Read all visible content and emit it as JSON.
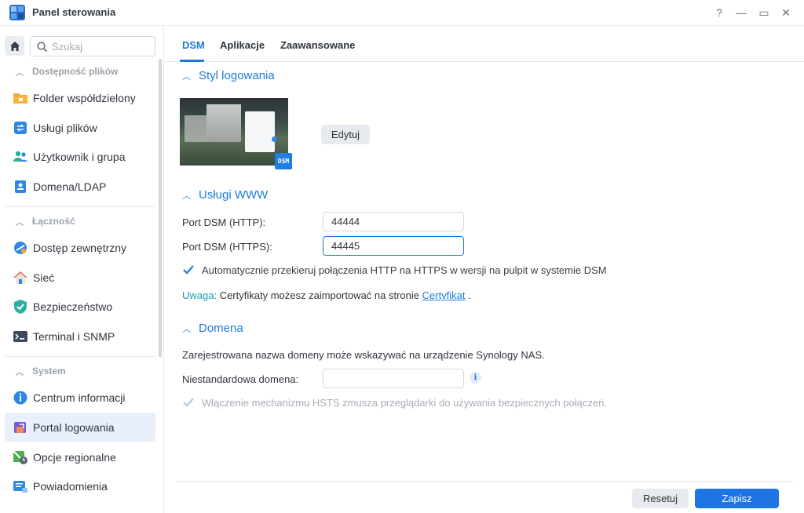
{
  "window": {
    "title": "Panel sterowania",
    "controls": {
      "help": "?",
      "minimize": "—",
      "maximize": "▭",
      "close": "✕"
    }
  },
  "sidebar": {
    "search_placeholder": "Szukaj",
    "groups": [
      {
        "label": "Dostępność plików",
        "items": [
          {
            "label": "Folder współdzielony",
            "icon": "shared-folder-icon"
          },
          {
            "label": "Usługi plików",
            "icon": "file-services-icon"
          },
          {
            "label": "Użytkownik i grupa",
            "icon": "user-group-icon"
          },
          {
            "label": "Domena/LDAP",
            "icon": "domain-ldap-icon"
          }
        ]
      },
      {
        "label": "Łączność",
        "items": [
          {
            "label": "Dostęp zewnętrzny",
            "icon": "external-access-icon"
          },
          {
            "label": "Sieć",
            "icon": "network-icon"
          },
          {
            "label": "Bezpieczeństwo",
            "icon": "security-shield-icon"
          },
          {
            "label": "Terminal i SNMP",
            "icon": "terminal-icon"
          }
        ]
      },
      {
        "label": "System",
        "items": [
          {
            "label": "Centrum informacji",
            "icon": "info-center-icon"
          },
          {
            "label": "Portal logowania",
            "icon": "login-portal-icon",
            "active": true
          },
          {
            "label": "Opcje regionalne",
            "icon": "regional-options-icon"
          },
          {
            "label": "Powiadomienia",
            "icon": "notifications-icon"
          }
        ]
      }
    ]
  },
  "tabs": [
    {
      "label": "DSM",
      "active": true
    },
    {
      "label": "Aplikacje"
    },
    {
      "label": "Zaawansowane"
    }
  ],
  "login_style": {
    "title": "Styl logowania",
    "edit_button": "Edytuj",
    "preview_badge": "DSM"
  },
  "web_services": {
    "title": "Usługi WWW",
    "http_label": "Port DSM (HTTP):",
    "http_value": "44444",
    "https_label": "Port DSM (HTTPS):",
    "https_value": "44445",
    "redirect_label": "Automatycznie przekieruj połączenia HTTP na HTTPS w wersji na pulpit w systemie DSM",
    "redirect_checked": true,
    "note_prefix": "Uwaga:",
    "note_text": " Certyfikaty możesz zaimportować na stronie ",
    "note_link": "Certyfikat",
    "note_suffix": " ."
  },
  "domain": {
    "title": "Domena",
    "description": "Zarejestrowana nazwa domeny może wskazywać na urządzenie Synology NAS.",
    "custom_label": "Niestandardowa domena:",
    "custom_value": "",
    "hsts_label": "Włączenie mechanizmu HSTS zmusza przeglądarki do używania bezpiecznych połączeń.",
    "hsts_checked": true,
    "hsts_disabled": true
  },
  "footer": {
    "reset_label": "Resetuj",
    "save_label": "Zapisz"
  },
  "colors": {
    "accent": "#1b7bdc",
    "note_highlight": "#1a9eae",
    "active_nav_bg": "#e8f0fb"
  }
}
